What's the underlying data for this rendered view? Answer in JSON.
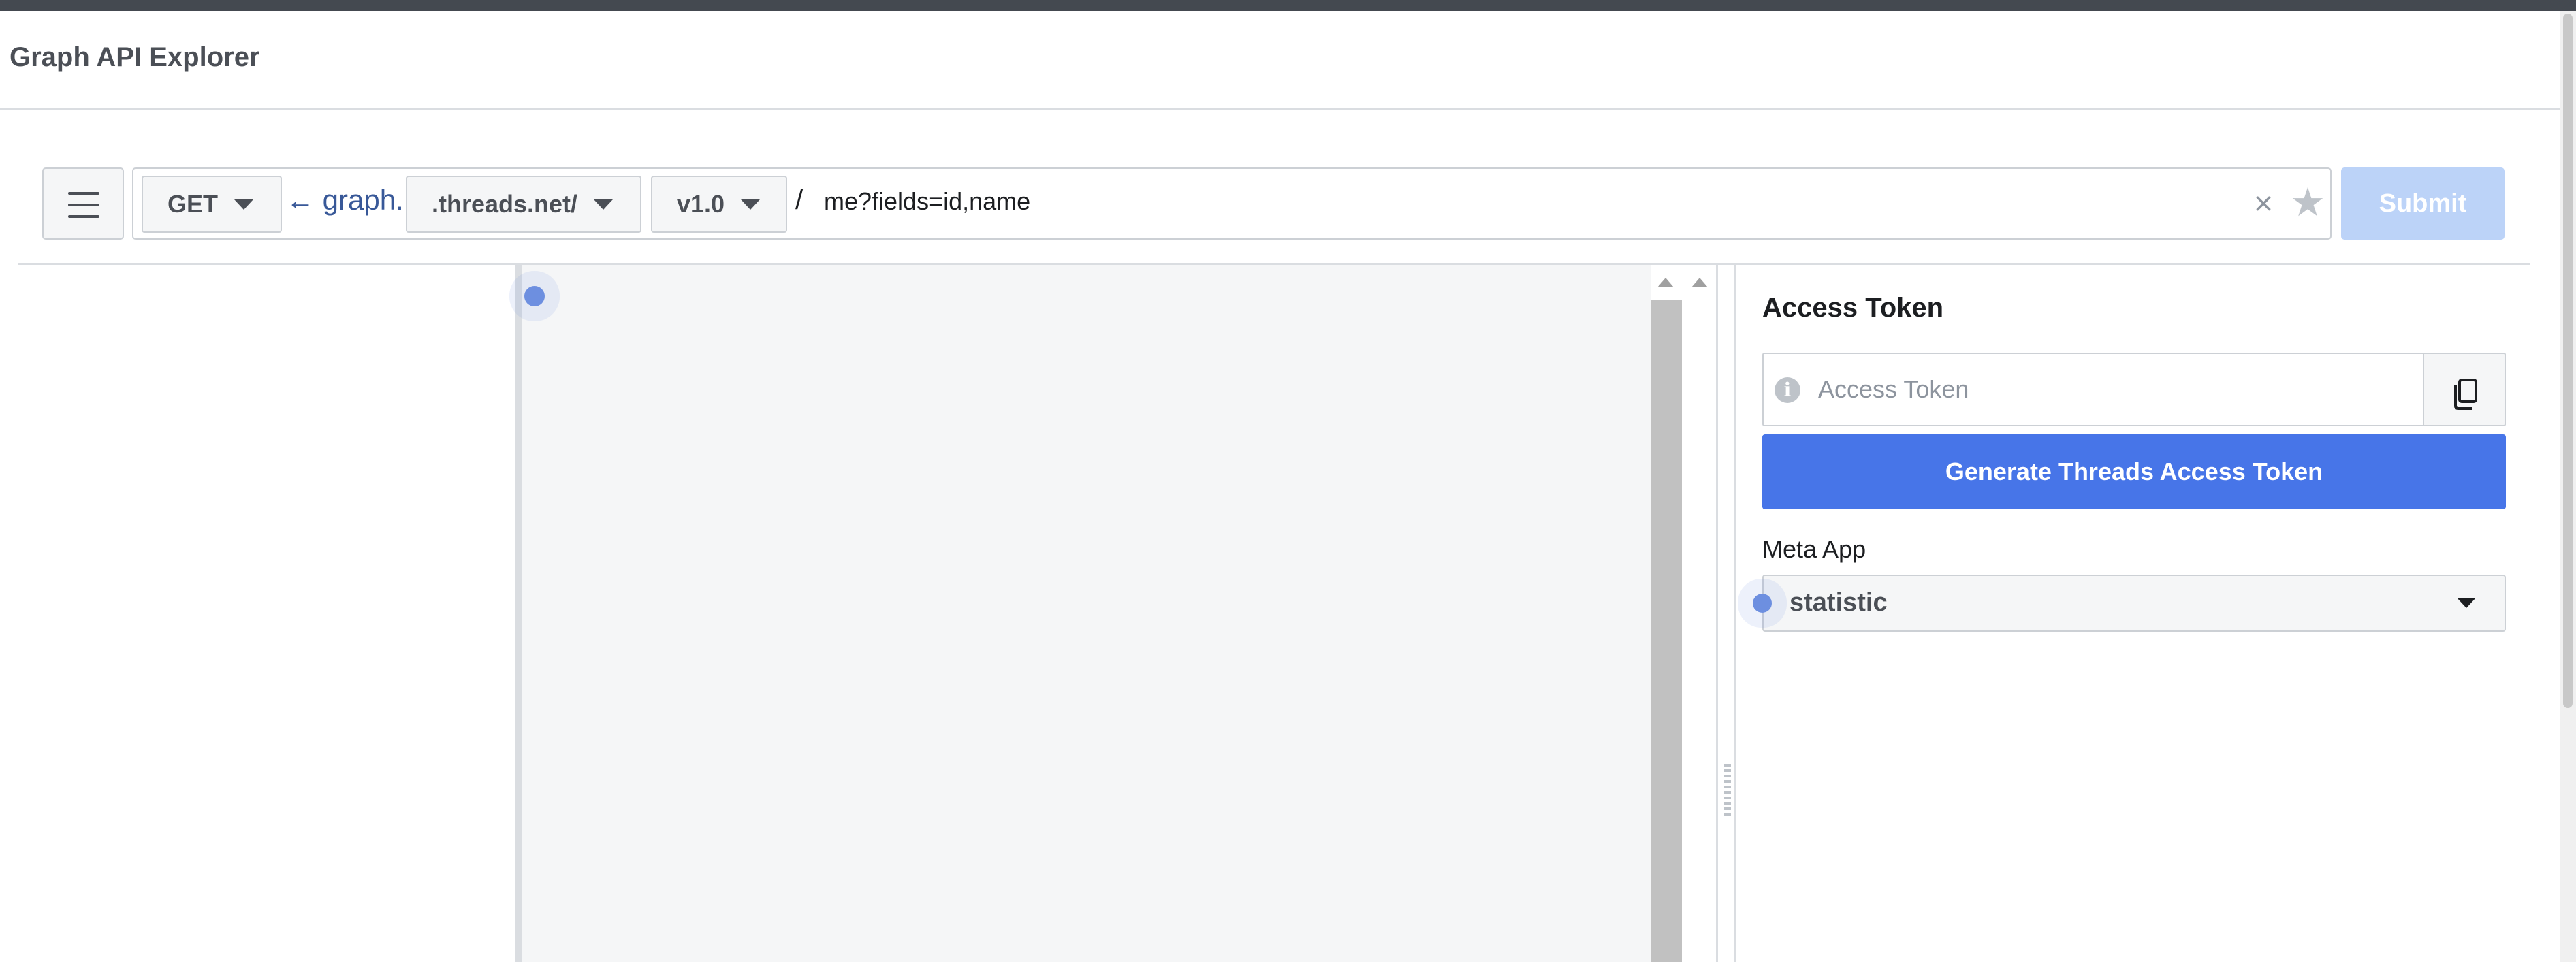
{
  "header": {
    "title": "Graph API Explorer"
  },
  "query": {
    "method": "GET",
    "graph_prefix": "← graph.",
    "domain": ".threads.net/",
    "version": "v1.0",
    "separator": "/",
    "path": "me?fields=id,name",
    "clear_glyph": "×",
    "star_glyph": "★",
    "submit_label": "Submit"
  },
  "access_token": {
    "heading": "Access Token",
    "placeholder": "Access Token",
    "info_glyph": "i",
    "generate_label": "Generate Threads Access Token"
  },
  "meta_app": {
    "label": "Meta App",
    "selected": "statistic"
  },
  "colors": {
    "accent": "#4775e8",
    "submit_disabled": "#bcd3f8",
    "link": "#385898",
    "top_strip": "#444950"
  },
  "icons": {
    "menu": "hamburger-icon",
    "clear": "close-icon",
    "favorite": "star-icon",
    "info": "info-icon",
    "copy": "copy-icon",
    "dropdown": "chevron-down-icon"
  }
}
